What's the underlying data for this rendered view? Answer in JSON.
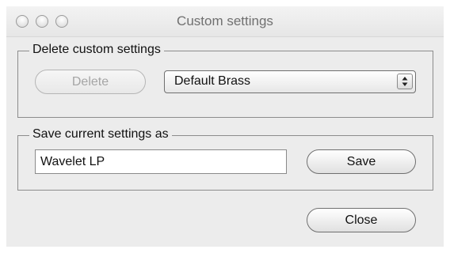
{
  "window": {
    "title": "Custom settings"
  },
  "delete_group": {
    "legend": "Delete custom settings",
    "delete_label": "Delete",
    "delete_enabled": false,
    "select_value": "Default Brass"
  },
  "save_group": {
    "legend": "Save current settings as",
    "name_value": "Wavelet LP",
    "save_label": "Save"
  },
  "footer": {
    "close_label": "Close"
  }
}
